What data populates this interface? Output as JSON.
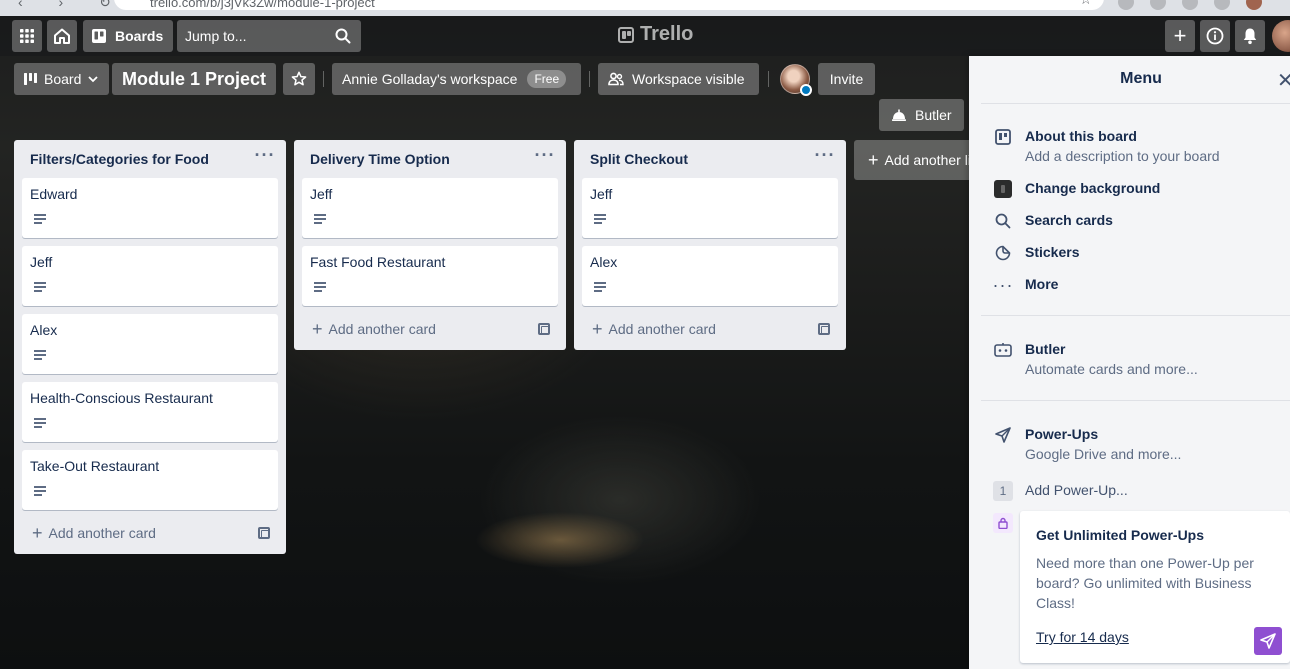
{
  "browser": {
    "url": "trello.com/b/j3jVk3Zw/module-1-project"
  },
  "header": {
    "boards_label": "Boards",
    "jump_placeholder": "Jump to...",
    "logo_text": "Trello"
  },
  "board": {
    "view_label": "Board",
    "title": "Module 1 Project",
    "workspace_label": "Annie Golladay's workspace",
    "workspace_badge": "Free",
    "visibility_label": "Workspace visible",
    "invite_label": "Invite",
    "butler_label": "Butler",
    "add_list_label": "Add another list"
  },
  "lists": [
    {
      "title": "Filters/Categories for Food",
      "cards": [
        "Edward",
        "Jeff",
        "Alex",
        "Health-Conscious Restaurant",
        "Take-Out Restaurant"
      ],
      "add_card_label": "Add another card"
    },
    {
      "title": "Delivery Time Option",
      "cards": [
        "Jeff",
        "Fast Food Restaurant"
      ],
      "add_card_label": "Add another card"
    },
    {
      "title": "Split Checkout",
      "cards": [
        "Jeff",
        "Alex"
      ],
      "add_card_label": "Add another card"
    }
  ],
  "menu": {
    "title": "Menu",
    "about_label": "About this board",
    "about_sub": "Add a description to your board",
    "change_bg_label": "Change background",
    "search_cards_label": "Search cards",
    "stickers_label": "Stickers",
    "more_label": "More",
    "butler_label": "Butler",
    "butler_sub": "Automate cards and more...",
    "powerups_label": "Power-Ups",
    "powerups_sub": "Google Drive and more...",
    "powerup_count": "1",
    "add_powerup_label": "Add Power-Up...",
    "promo_title": "Get Unlimited Power-Ups",
    "promo_text": "Need more than one Power-Up per board? Go unlimited with Business Class!",
    "promo_link": "Try for 14 days"
  },
  "colors": {
    "accent_purple": "#8f4fd1",
    "list_bg": "#ebecf0",
    "panel_bg": "#f4f5f7"
  }
}
